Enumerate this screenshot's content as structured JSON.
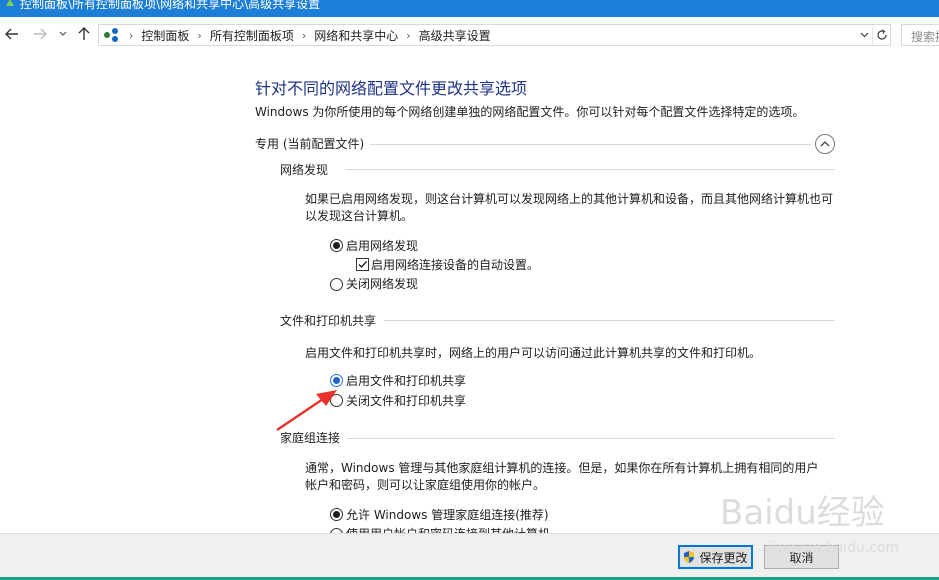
{
  "window": {
    "title": "控制面板\\所有控制面板项\\网络和共享中心\\高级共享设置"
  },
  "navigation": {
    "breadcrumbs": [
      "控制面板",
      "所有控制面板项",
      "网络和共享中心",
      "高级共享设置"
    ],
    "search_placeholder": "搜索控"
  },
  "main": {
    "heading": "针对不同的网络配置文件更改共享选项",
    "description": "Windows 为你所使用的每个网络创建单独的网络配置文件。你可以针对每个配置文件选择特定的选项。",
    "profile": {
      "label": "专用 (当前配置文件)",
      "sections": {
        "network_discovery": {
          "title": "网络发现",
          "text": "如果已启用网络发现，则这台计算机可以发现网络上的其他计算机和设备，而且其他网络计算机也可以发现这台计算机。",
          "on_label": "启用网络发现",
          "auto_setup_label": "启用网络连接设备的自动设置。",
          "off_label": "关闭网络发现"
        },
        "file_printer": {
          "title": "文件和打印机共享",
          "text": "启用文件和打印机共享时，网络上的用户可以访问通过此计算机共享的文件和打印机。",
          "on_label": "启用文件和打印机共享",
          "off_label": "关闭文件和打印机共享"
        },
        "homegroup": {
          "title": "家庭组连接",
          "text": "通常，Windows 管理与其他家庭组计算机的连接。但是，如果你在所有计算机上拥有相同的用户帐户和密码，则可以让家庭组使用你的帐户。",
          "allow_label": "允许 Windows 管理家庭组连接(推荐)",
          "use_accounts_label": "使用用户帐户和密码连接到其他计算机"
        }
      }
    }
  },
  "footer": {
    "save_label": "保存更改",
    "cancel_label": "取消"
  },
  "watermark": {
    "text": "Baidu经验",
    "url": "jingyan.baidu.com"
  },
  "colors": {
    "title_bar": "#1c7ed6",
    "heading": "#1e3287",
    "annotation_arrow": "#e8322c"
  }
}
